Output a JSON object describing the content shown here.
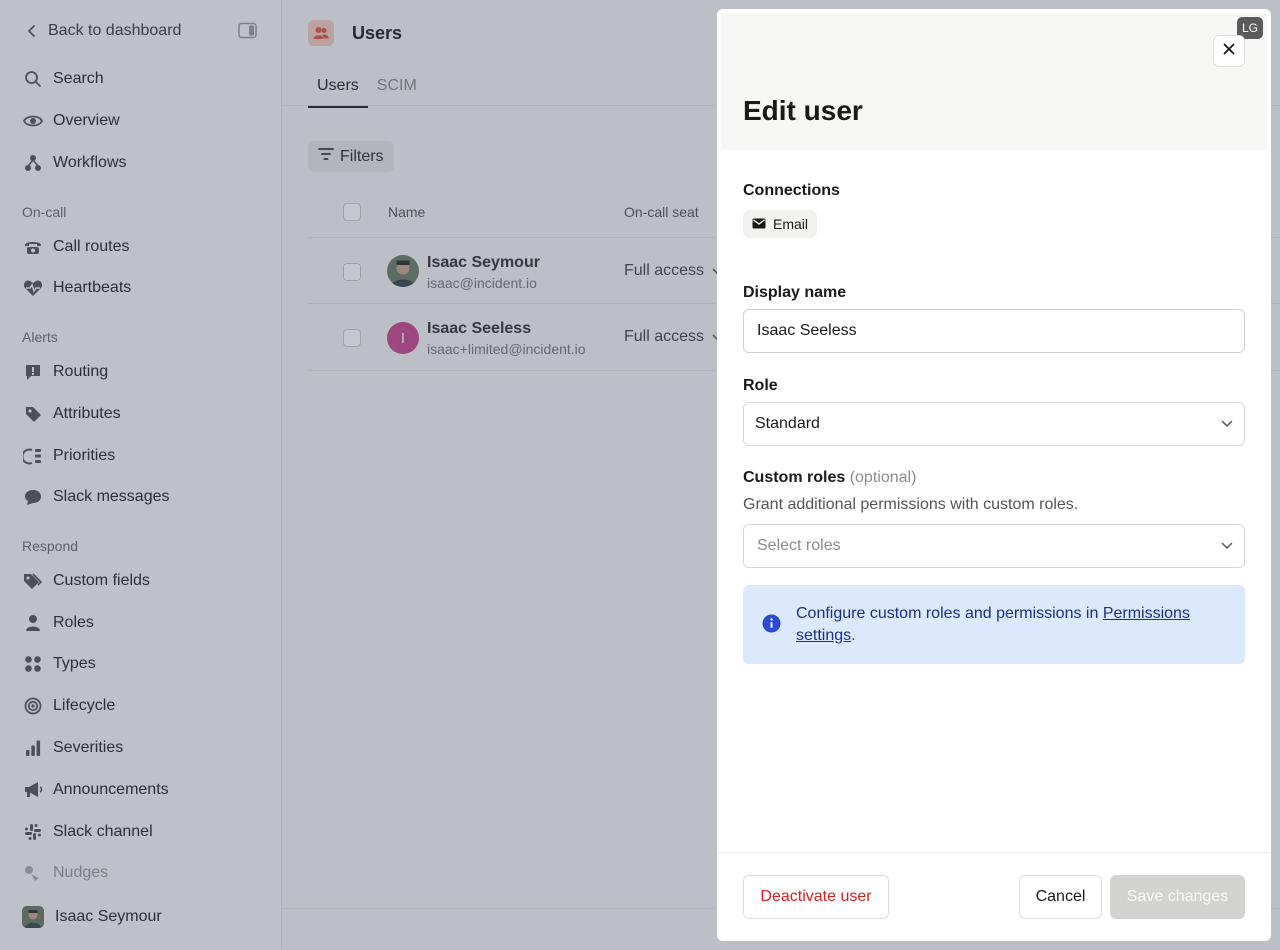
{
  "sidebar": {
    "back_label": "Back to dashboard",
    "top_items": [
      {
        "label": "Search",
        "icon": "search-icon"
      },
      {
        "label": "Overview",
        "icon": "eye-icon"
      },
      {
        "label": "Workflows",
        "icon": "workflow-icon"
      }
    ],
    "sections": [
      {
        "title": "On-call",
        "items": [
          {
            "label": "Call routes",
            "icon": "phone-icon"
          },
          {
            "label": "Heartbeats",
            "icon": "heartbeat-icon"
          }
        ]
      },
      {
        "title": "Alerts",
        "items": [
          {
            "label": "Routing",
            "icon": "alert-bubble-icon"
          },
          {
            "label": "Attributes",
            "icon": "tag-icon"
          },
          {
            "label": "Priorities",
            "icon": "priority-icon"
          },
          {
            "label": "Slack messages",
            "icon": "message-icon"
          }
        ]
      },
      {
        "title": "Respond",
        "items": [
          {
            "label": "Custom fields",
            "icon": "tags-icon"
          },
          {
            "label": "Roles",
            "icon": "person-icon"
          },
          {
            "label": "Types",
            "icon": "grid-icon"
          },
          {
            "label": "Lifecycle",
            "icon": "lifecycle-icon"
          },
          {
            "label": "Severities",
            "icon": "bars-icon"
          },
          {
            "label": "Announcements",
            "icon": "megaphone-icon"
          },
          {
            "label": "Slack channel",
            "icon": "slack-icon"
          },
          {
            "label": "Nudges",
            "icon": "nudge-icon"
          }
        ]
      }
    ],
    "user_name": "Isaac Seymour"
  },
  "main": {
    "title": "Users",
    "tabs": [
      {
        "label": "Users",
        "active": true
      },
      {
        "label": "SCIM",
        "active": false
      }
    ],
    "filters_label": "Filters",
    "columns": {
      "name": "Name",
      "seat": "On-call seat"
    },
    "rows": [
      {
        "name": "Isaac Seymour",
        "email": "isaac@incident.io",
        "seat": "Full access",
        "avatar": "photo"
      },
      {
        "name": "Isaac Seeless",
        "email": "isaac+limited@incident.io",
        "seat": "Full access",
        "avatar": "I",
        "avatar_color": "#c9488f"
      }
    ]
  },
  "drawer": {
    "badge": "LG",
    "title": "Edit user",
    "connections_label": "Connections",
    "connection_chip": "Email",
    "display_name_label": "Display name",
    "display_name_value": "Isaac Seeless",
    "role_label": "Role",
    "role_value": "Standard",
    "custom_roles_label": "Custom roles",
    "custom_roles_optional": "(optional)",
    "custom_roles_help": "Grant additional permissions with custom roles.",
    "custom_roles_placeholder": "Select roles",
    "info_text_before": "Configure custom roles and permissions in ",
    "info_link": "Permissions settings",
    "info_text_after": ".",
    "deactivate_label": "Deactivate user",
    "cancel_label": "Cancel",
    "save_label": "Save changes"
  },
  "colors": {
    "danger": "#d42020",
    "info_bg": "#dce8fb",
    "info_text": "#1c2f86",
    "overlay": "rgba(58,70,92,0.30)"
  }
}
